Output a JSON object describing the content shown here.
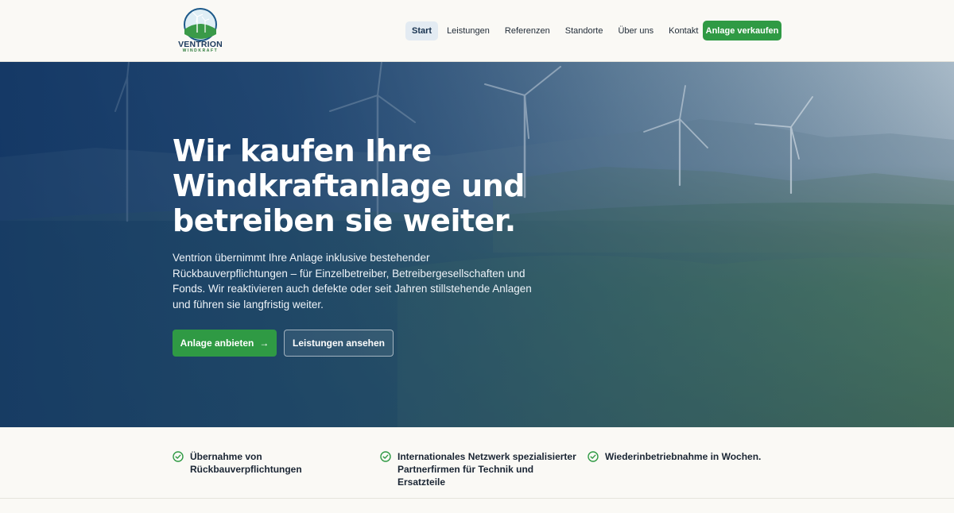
{
  "logo": {
    "name": "VENTRION",
    "sub": "WINDKRAFT"
  },
  "nav": {
    "items": [
      {
        "label": "Start",
        "active": true
      },
      {
        "label": "Leistungen",
        "active": false
      },
      {
        "label": "Referenzen",
        "active": false
      },
      {
        "label": "Standorte",
        "active": false
      },
      {
        "label": "Über uns",
        "active": false
      },
      {
        "label": "Kontakt",
        "active": false
      }
    ],
    "cta": "Anlage verkaufen"
  },
  "hero": {
    "title_line1": "Wir kaufen Ihre",
    "title_line2": "Windkraftanlage und",
    "title_line3": "betreiben sie weiter.",
    "text": "Ventrion übernimmt Ihre Anlage inklusive bestehender Rückbauverpflichtungen – für Einzelbetreiber, Betreibergesellschaften und Fonds. Wir reaktivieren auch defekte oder seit Jahren stillstehende Anlagen und führen sie langfristig weiter.",
    "primary_button": "Anlage anbieten",
    "primary_arrow": "→",
    "secondary_button": "Leistungen ansehen"
  },
  "features": [
    {
      "text": "Übernahme von Rückbauverpflichtungen"
    },
    {
      "text": "Internationales Netzwerk spezialisierter Partnerfirmen für Technik und Ersatzteile"
    },
    {
      "text": "Wiederinbetriebnahme in Wochen."
    }
  ],
  "colors": {
    "accent": "#2f9a44",
    "navy": "#18324f",
    "background": "#faf9f5"
  }
}
